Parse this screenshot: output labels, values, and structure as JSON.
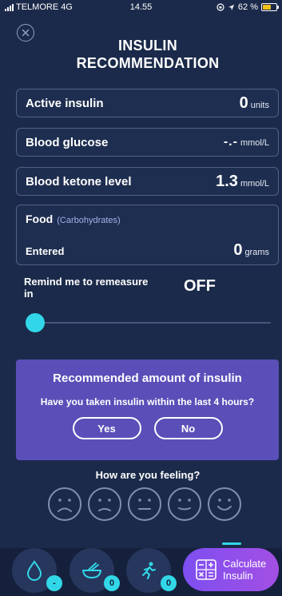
{
  "status_bar": {
    "carrier": "TELMORE",
    "network": "4G",
    "time": "14.55",
    "battery": "62 %"
  },
  "header": {
    "title_line1": "INSULIN",
    "title_line2": "RECOMMENDATION"
  },
  "active_insulin": {
    "label": "Active insulin",
    "value": "0",
    "unit": "units"
  },
  "blood_glucose": {
    "label": "Blood glucose",
    "value": "-.-",
    "unit": "mmol/L"
  },
  "blood_ketone": {
    "label": "Blood ketone level",
    "value": "1.3",
    "unit": "mmol/L"
  },
  "food": {
    "label": "Food",
    "sublabel": "(Carbohydrates)",
    "entered_label": "Entered",
    "value": "0",
    "unit": "grams"
  },
  "remind": {
    "label": "Remind me to remeasure in",
    "value": "OFF",
    "slider_level": 0
  },
  "recommendation": {
    "title": "Recommended amount of insulin",
    "question": "Have you taken insulin within the last 4 hours?",
    "yes_label": "Yes",
    "no_label": "No"
  },
  "feeling": {
    "label": "How are you feeling?",
    "faces": [
      "very-sad-face-icon",
      "sad-face-icon",
      "neutral-face-icon",
      "content-face-icon",
      "happy-face-icon"
    ]
  },
  "bottom_nav": {
    "glucose_badge": "-",
    "food_badge": "0",
    "activity_badge": "0",
    "calculate_label_line1": "Calculate",
    "calculate_label_line2": "Insulin"
  },
  "colors": {
    "background": "#1b2a4a",
    "accent": "#31d7e8",
    "recommend_panel": "#5a4fb8",
    "calculate_gradient": [
      "#7d4ff0",
      "#a34fe4"
    ]
  }
}
